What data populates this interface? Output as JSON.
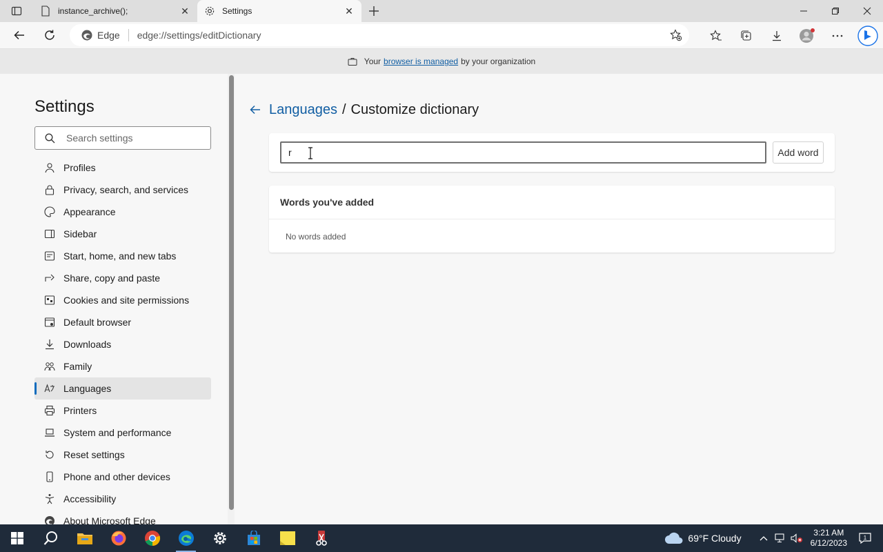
{
  "browser": {
    "tabs": [
      {
        "title": "instance_archive();",
        "active": false,
        "icon": "page-icon"
      },
      {
        "title": "Settings",
        "active": true,
        "icon": "gear-icon"
      }
    ],
    "address": {
      "identity": "Edge",
      "url": "edge://settings/editDictionary"
    },
    "managed_bar": {
      "prefix": "Your",
      "link": "browser is managed",
      "suffix": "by your organization"
    }
  },
  "sidebar": {
    "title": "Settings",
    "search_placeholder": "Search settings",
    "items": [
      {
        "label": "Profiles",
        "icon": "profile-icon"
      },
      {
        "label": "Privacy, search, and services",
        "icon": "lock-icon"
      },
      {
        "label": "Appearance",
        "icon": "palette-icon"
      },
      {
        "label": "Sidebar",
        "icon": "sidebar-icon"
      },
      {
        "label": "Start, home, and new tabs",
        "icon": "home-icon"
      },
      {
        "label": "Share, copy and paste",
        "icon": "share-icon"
      },
      {
        "label": "Cookies and site permissions",
        "icon": "cookie-icon"
      },
      {
        "label": "Default browser",
        "icon": "browser-icon"
      },
      {
        "label": "Downloads",
        "icon": "download-icon"
      },
      {
        "label": "Family",
        "icon": "family-icon"
      },
      {
        "label": "Languages",
        "icon": "language-icon",
        "selected": true
      },
      {
        "label": "Printers",
        "icon": "printer-icon"
      },
      {
        "label": "System and performance",
        "icon": "laptop-icon"
      },
      {
        "label": "Reset settings",
        "icon": "reset-icon"
      },
      {
        "label": "Phone and other devices",
        "icon": "phone-icon"
      },
      {
        "label": "Accessibility",
        "icon": "accessibility-icon"
      },
      {
        "label": "About Microsoft Edge",
        "icon": "edge-icon"
      }
    ]
  },
  "main": {
    "breadcrumb_parent": "Languages",
    "breadcrumb_sep": "/",
    "breadcrumb_current": "Customize dictionary",
    "word_input_value": "r",
    "add_word_label": "Add word",
    "words_header": "Words you've added",
    "words_empty": "No words added"
  },
  "taskbar": {
    "weather": "69°F  Cloudy",
    "time": "3:21 AM",
    "date": "6/12/2023"
  }
}
